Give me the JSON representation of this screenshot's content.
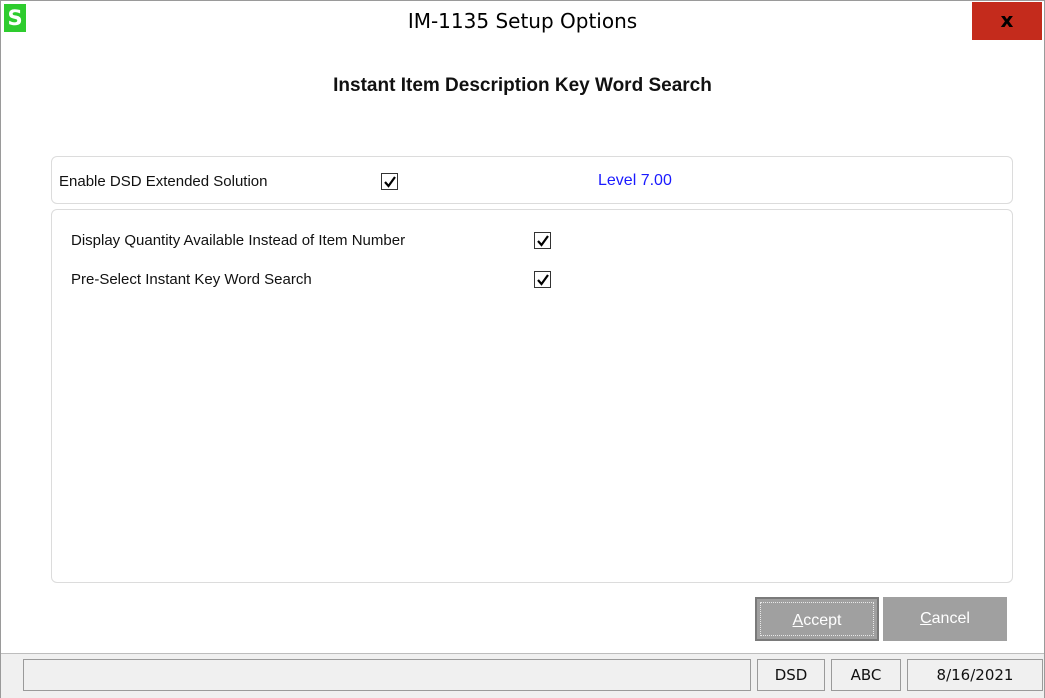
{
  "window": {
    "title": "IM-1135 Setup Options",
    "app_icon_letter": "S",
    "close_glyph": "x"
  },
  "dialog": {
    "heading": "Instant Item Description Key Word Search"
  },
  "group_top": {
    "enable_label": "Enable DSD Extended Solution",
    "enable_checked": true,
    "level_text": "Level  7.00"
  },
  "options": [
    {
      "label": "Display Quantity Available Instead of Item Number",
      "checked": true
    },
    {
      "label": "Pre-Select Instant Key Word Search",
      "checked": true
    }
  ],
  "buttons": {
    "accept_mnemonic": "A",
    "accept_rest": "ccept",
    "cancel_mnemonic": "C",
    "cancel_rest": "ancel"
  },
  "statusbar": {
    "panel1": "",
    "panel2": "DSD",
    "panel3": "ABC",
    "panel4": "8/16/2021"
  },
  "colors": {
    "app_icon_bg": "#2ecc2e",
    "close_bg": "#c42b1c",
    "level_text": "#1a1aff",
    "button_bg": "#a0a0a0"
  }
}
